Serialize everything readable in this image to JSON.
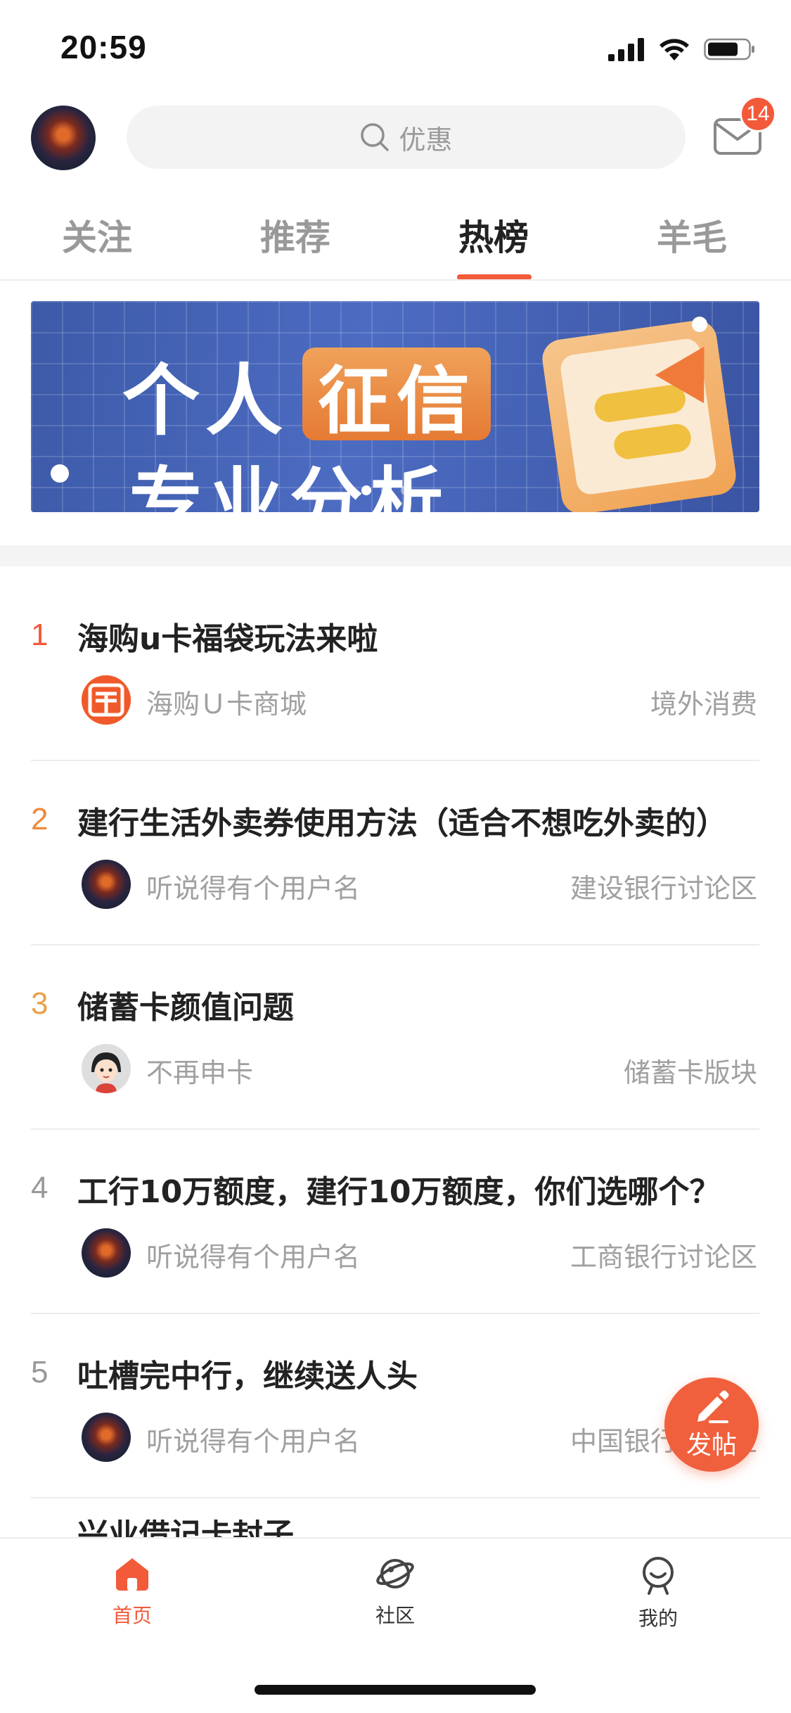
{
  "status_bar": {
    "time": "20:59"
  },
  "header": {
    "search_placeholder": "优惠",
    "mail_badge": "14"
  },
  "tabs": [
    {
      "label": "关注"
    },
    {
      "label": "推荐"
    },
    {
      "label": "热榜",
      "active": true
    },
    {
      "label": "羊毛"
    }
  ],
  "banner": {
    "line1_a": "个人",
    "line1_b": "征信",
    "line2": "专业分析"
  },
  "hot_list": [
    {
      "rank": "1",
      "rank_color": "#f25a3a",
      "title": "海购u卡福袋玩法来啦",
      "author": "海购Ｕ卡商城",
      "forum": "境外消费"
    },
    {
      "rank": "2",
      "rank_color": "#f0883a",
      "title": "建行生活外卖券使用方法（适合不想吃外卖的）",
      "author": "听说得有个用户名",
      "forum": "建设银行讨论区"
    },
    {
      "rank": "3",
      "rank_color": "#e8a24a",
      "title": "储蓄卡颜值问题",
      "author": "不再申卡",
      "forum": "储蓄卡版块"
    },
    {
      "rank": "4",
      "rank_color": "#999999",
      "title": "工行10万额度，建行10万额度，你们选哪个？",
      "author": "听说得有个用户名",
      "forum": "工商银行讨论区"
    },
    {
      "rank": "5",
      "rank_color": "#999999",
      "title": "吐槽完中行，继续送人头",
      "author": "听说得有个用户名",
      "forum": "中国银行讨论区"
    }
  ],
  "peek_item": {
    "title": "兴业借记卡封子"
  },
  "fab": {
    "label": "发帖"
  },
  "bottom_nav": [
    {
      "label": "首页",
      "active": true
    },
    {
      "label": "社区"
    },
    {
      "label": "我的"
    }
  ],
  "colors": {
    "accent": "#f25a3a"
  }
}
